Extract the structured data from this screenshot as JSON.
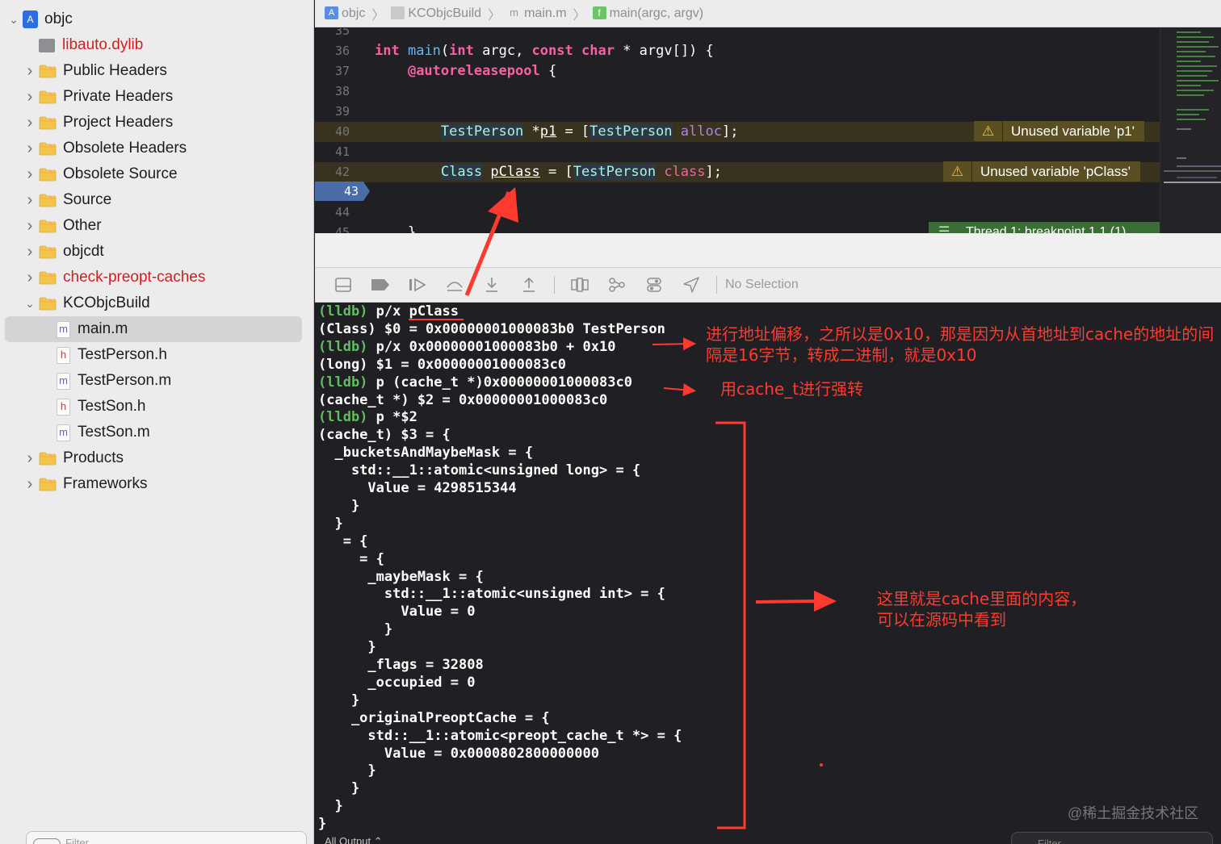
{
  "sidebar": {
    "items": [
      {
        "label": "objc",
        "type": "project",
        "chevron": "down"
      },
      {
        "label": "libauto.dylib",
        "type": "library",
        "chevron": "",
        "red": true
      },
      {
        "label": "Public Headers",
        "type": "folder",
        "chevron": "right"
      },
      {
        "label": "Private Headers",
        "type": "folder",
        "chevron": "right"
      },
      {
        "label": "Project Headers",
        "type": "folder",
        "chevron": "right"
      },
      {
        "label": "Obsolete Headers",
        "type": "folder",
        "chevron": "right"
      },
      {
        "label": "Obsolete Source",
        "type": "folder",
        "chevron": "right"
      },
      {
        "label": "Source",
        "type": "folder",
        "chevron": "right"
      },
      {
        "label": "Other",
        "type": "folder",
        "chevron": "right"
      },
      {
        "label": "objcdt",
        "type": "folder",
        "chevron": "right"
      },
      {
        "label": "check-preopt-caches",
        "type": "folder",
        "chevron": "right",
        "red": true
      },
      {
        "label": "KCObjcBuild",
        "type": "folder",
        "chevron": "down"
      },
      {
        "label": "main.m",
        "type": "file-m",
        "chevron": "",
        "selected": true
      },
      {
        "label": "TestPerson.h",
        "type": "file-h",
        "chevron": ""
      },
      {
        "label": "TestPerson.m",
        "type": "file-m",
        "chevron": ""
      },
      {
        "label": "TestSon.h",
        "type": "file-h",
        "chevron": ""
      },
      {
        "label": "TestSon.m",
        "type": "file-m",
        "chevron": ""
      },
      {
        "label": "Products",
        "type": "folder",
        "chevron": "right"
      },
      {
        "label": "Frameworks",
        "type": "folder",
        "chevron": "right"
      }
    ],
    "filter_placeholder": "Filter"
  },
  "jumpbar": {
    "crumbs": [
      {
        "label": "objc",
        "icon": "project-icon"
      },
      {
        "label": "KCObjcBuild",
        "icon": "folder-icon"
      },
      {
        "label": "main.m",
        "icon": "m-file-icon"
      },
      {
        "label": "main(argc, argv)",
        "icon": "function-icon"
      }
    ]
  },
  "editor": {
    "lines": [
      {
        "num": "35",
        "html": ""
      },
      {
        "num": "36",
        "html": "<span class='kw'>int</span> <span class='fn'>main</span>(<span class='kw'>int</span> argc, <span class='kw'>const</span> <span class='kw'>char</span> * argv[]) {"
      },
      {
        "num": "37",
        "html": "    <span class='kw'>@autoreleasepool</span> {"
      },
      {
        "num": "38",
        "html": ""
      },
      {
        "num": "39",
        "html": ""
      },
      {
        "num": "40",
        "html": "        <span class='ty'>TestPerson</span> *<u>p1</u> = [<span class='ty'>TestPerson</span> <span class='mth'>alloc</span>];",
        "warn": true
      },
      {
        "num": "41",
        "html": ""
      },
      {
        "num": "42",
        "html": "        <span class='ty'>Class</span> <u>pClass</u> = [<span class='ty'>TestPerson</span> <span class='kw2'>class</span>];",
        "warn": true
      },
      {
        "num": "43",
        "html": ""
      },
      {
        "num": "44",
        "html": ""
      },
      {
        "num": "45",
        "html": "    }"
      }
    ],
    "pc_line": "43",
    "warnings": [
      {
        "message": "Unused variable 'p1'"
      },
      {
        "message": "Unused variable 'pClass'"
      }
    ],
    "thread_badge": "Thread 1: breakpoint 1.1 (1)"
  },
  "debugbar": {
    "buttons": [
      "hide-debug-area-icon",
      "breakpoints-toggle-icon",
      "continue-icon",
      "step-over-icon",
      "step-into-icon",
      "step-out-icon",
      "view-debugger-icon",
      "memory-graph-icon",
      "environment-overrides-icon",
      "location-icon"
    ],
    "selection_label": "No Selection"
  },
  "console": {
    "prompt": "(lldb)",
    "lines": [
      {
        "prompt": true,
        "text": " p/x pClass"
      },
      {
        "prompt": false,
        "text": "(Class) $0 = 0x00000001000083b0 TestPerson"
      },
      {
        "prompt": true,
        "text": " p/x 0x00000001000083b0 + 0x10"
      },
      {
        "prompt": false,
        "text": "(long) $1 = 0x00000001000083c0"
      },
      {
        "prompt": true,
        "text": " p (cache_t *)0x00000001000083c0"
      },
      {
        "prompt": false,
        "text": "(cache_t *) $2 = 0x00000001000083c0"
      },
      {
        "prompt": true,
        "text": " p *$2"
      },
      {
        "prompt": false,
        "text": "(cache_t) $3 = {"
      },
      {
        "prompt": false,
        "text": "  _bucketsAndMaybeMask = {"
      },
      {
        "prompt": false,
        "text": "    std::__1::atomic<unsigned long> = {"
      },
      {
        "prompt": false,
        "text": "      Value = 4298515344"
      },
      {
        "prompt": false,
        "text": "    }"
      },
      {
        "prompt": false,
        "text": "  }"
      },
      {
        "prompt": false,
        "text": "   = {"
      },
      {
        "prompt": false,
        "text": "     = {"
      },
      {
        "prompt": false,
        "text": "      _maybeMask = {"
      },
      {
        "prompt": false,
        "text": "        std::__1::atomic<unsigned int> = {"
      },
      {
        "prompt": false,
        "text": "          Value = 0"
      },
      {
        "prompt": false,
        "text": "        }"
      },
      {
        "prompt": false,
        "text": "      }"
      },
      {
        "prompt": false,
        "text": "      _flags = 32808"
      },
      {
        "prompt": false,
        "text": "      _occupied = 0"
      },
      {
        "prompt": false,
        "text": "    }"
      },
      {
        "prompt": false,
        "text": "    _originalPreoptCache = {"
      },
      {
        "prompt": false,
        "text": "      std::__1::atomic<preopt_cache_t *> = {"
      },
      {
        "prompt": false,
        "text": "        Value = 0x0000802800000000"
      },
      {
        "prompt": false,
        "text": "      }"
      },
      {
        "prompt": false,
        "text": "    }"
      },
      {
        "prompt": false,
        "text": "  }"
      },
      {
        "prompt": false,
        "text": "}"
      }
    ],
    "output_selector": "All Output ⌃",
    "filter_placeholder": "Filter"
  },
  "annotations": {
    "offset_note": "进行地址偏移，之所以是0x10，那是因为从首地址到cache的地址的间隔是16字节，转成二进制，就是0x10",
    "cast_note": "用cache_t进行强转",
    "content_note": "这里就是cache里面的内容，可以在源码中看到",
    "color": "#ff3b30"
  },
  "watermark": "@稀土掘金技术社区"
}
